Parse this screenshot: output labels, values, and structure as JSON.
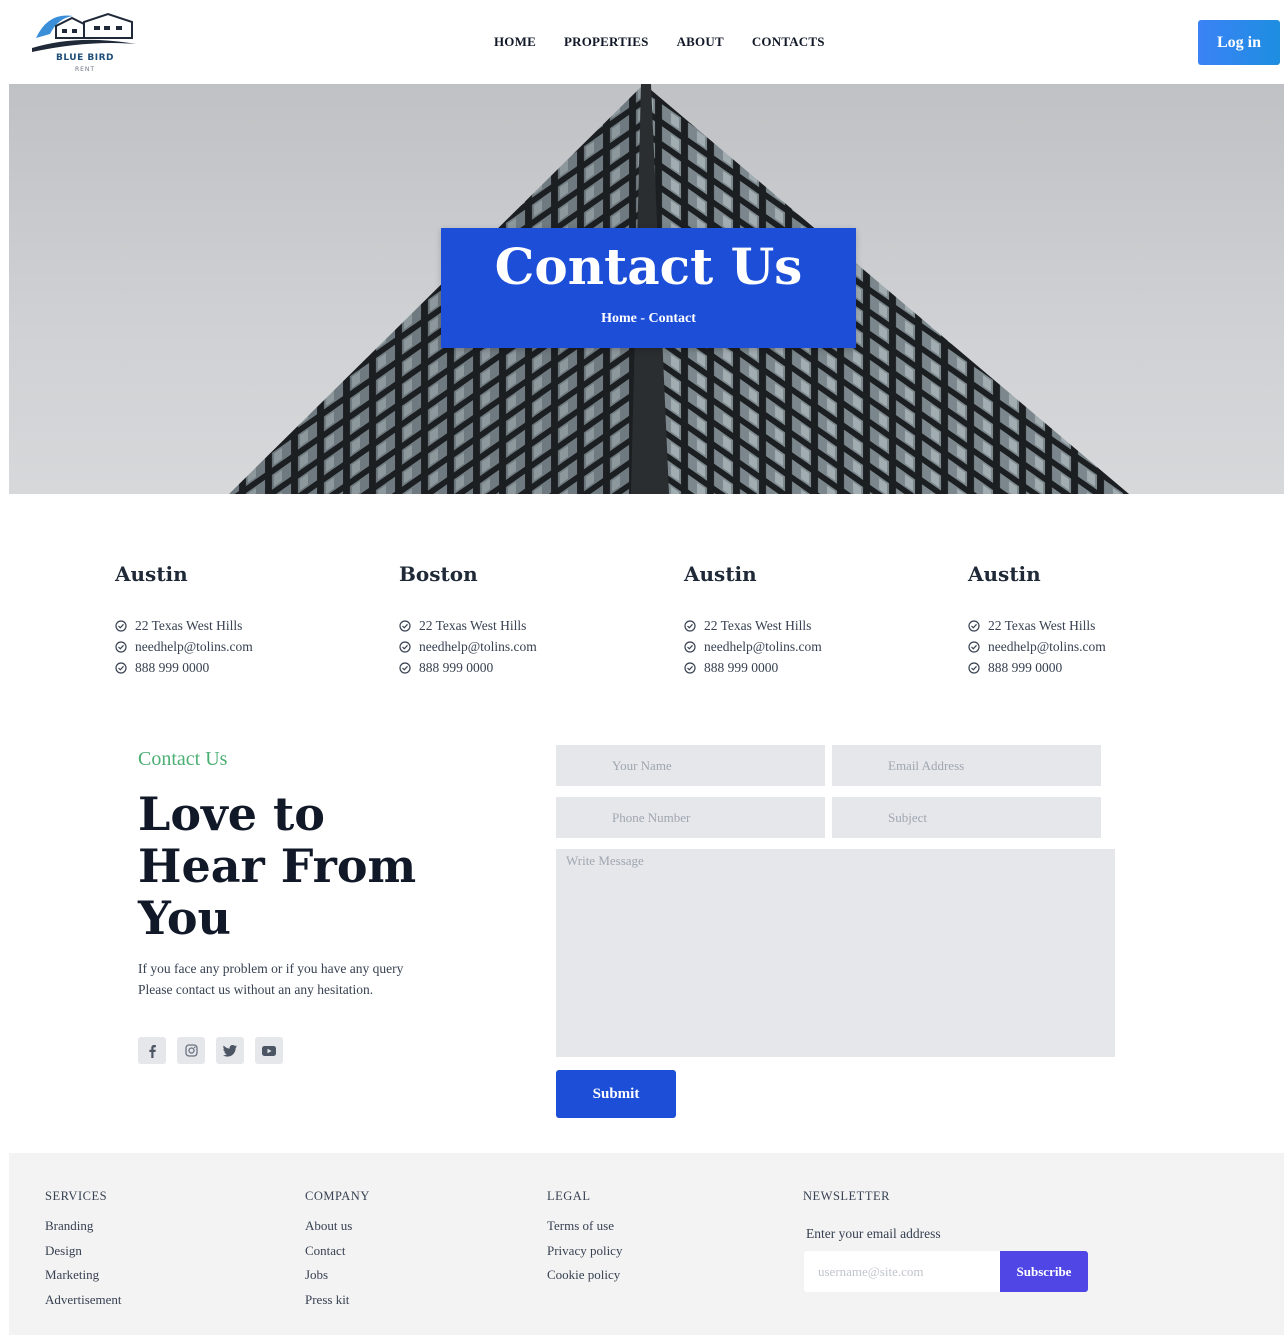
{
  "brand": {
    "name": "BLUE BIRD",
    "tagline": "RENT"
  },
  "nav": {
    "items": [
      "HOME",
      "PROPERTIES",
      "ABOUT",
      "CONTACTS"
    ]
  },
  "header": {
    "login_label": "Log in"
  },
  "hero": {
    "title": "Contact Us",
    "breadcrumb": "Home - Contact"
  },
  "offices": [
    {
      "city": "Austin",
      "address": "22 Texas West Hills",
      "email": "needhelp@tolins.com",
      "phone": "888 999 0000"
    },
    {
      "city": "Boston",
      "address": "22 Texas West Hills",
      "email": "needhelp@tolins.com",
      "phone": "888 999 0000"
    },
    {
      "city": "Austin",
      "address": "22 Texas West Hills",
      "email": "needhelp@tolins.com",
      "phone": "888 999 0000"
    },
    {
      "city": "Austin",
      "address": "22 Texas West Hills",
      "email": "needhelp@tolins.com",
      "phone": "888 999 0000"
    }
  ],
  "contact": {
    "eyebrow": "Contact Us",
    "title": "Love to Hear From You",
    "description": "If you face any problem or if you have any query Please contact us without an any hesitation.",
    "social_icons": [
      "facebook-icon",
      "instagram-icon",
      "twitter-icon",
      "youtube-icon"
    ]
  },
  "form": {
    "name_placeholder": "Your Name",
    "email_placeholder": "Email Address",
    "phone_placeholder": "Phone Number",
    "subject_placeholder": "Subject",
    "message_placeholder": "Write Message",
    "submit_label": "Submit"
  },
  "footer": {
    "columns": [
      {
        "heading": "SERVICES",
        "links": [
          "Branding",
          "Design",
          "Marketing",
          "Advertisement"
        ]
      },
      {
        "heading": "COMPANY",
        "links": [
          "About us",
          "Contact",
          "Jobs",
          "Press kit"
        ]
      },
      {
        "heading": "LEGAL",
        "links": [
          "Terms of use",
          "Privacy policy",
          "Cookie policy"
        ]
      }
    ],
    "newsletter": {
      "heading": "NEWSLETTER",
      "label": "Enter your email address",
      "placeholder": "username@site.com",
      "button_label": "Subscribe"
    }
  },
  "colors": {
    "primary": "#1d4ed8",
    "accent_green": "#4caf73",
    "subscribe": "#4f46e5",
    "login": "#3b82f6"
  }
}
